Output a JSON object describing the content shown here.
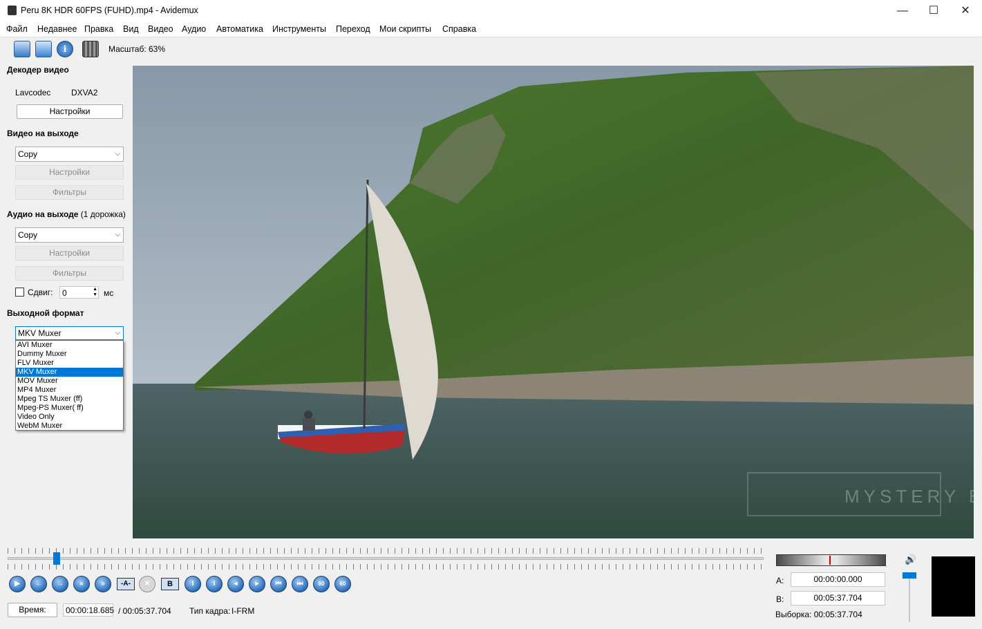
{
  "window": {
    "title": "Peru 8K HDR 60FPS (FUHD).mp4 - Avidemux",
    "minimize": "—",
    "maximize": "☐",
    "close": "✕"
  },
  "menu": [
    "Файл",
    "Недавнее",
    "Правка",
    "Вид",
    "Видео",
    "Аудио",
    "Автоматика",
    "Инструменты",
    "Переход",
    "Мои скрипты",
    "Справка"
  ],
  "toolbar": {
    "zoom": "Масштаб: 63%"
  },
  "decoder": {
    "title": "Декодер видео",
    "codec": "Lavcodec",
    "hw": "DXVA2",
    "settings": "Настройки"
  },
  "video_out": {
    "title": "Видео на выходе",
    "codec": "Copy",
    "settings": "Настройки",
    "filters": "Фильтры"
  },
  "audio_out": {
    "title": "Аудио на выходе",
    "tracks": "(1 дорожка)",
    "codec": "Copy",
    "settings": "Настройки",
    "filters": "Фильтры",
    "shift_label": "Сдвиг:",
    "shift_value": "0",
    "shift_unit": "мс"
  },
  "output_format": {
    "title": "Выходной формат",
    "selected": "MKV Muxer",
    "options": [
      "AVI Muxer",
      "Dummy Muxer",
      "FLV Muxer",
      "MKV Muxer",
      "MOV Muxer",
      "MP4 Muxer",
      "Mpeg TS Muxer (ff)",
      "Mpeg-PS Muxer( ff)",
      "Video Only",
      "WebM Muxer"
    ]
  },
  "video": {
    "watermark": "MYSTERY BOX"
  },
  "timeline": {
    "position_fraction": 0.065
  },
  "controls": {
    "a_label": "-A-",
    "b_label": "B",
    "sixty": "60"
  },
  "status": {
    "time_button": "Время:",
    "current": "00:00:18.685",
    "total": "/ 00:05:37.704",
    "frame_type_label": "Тип кадра:",
    "frame_type": "I-FRM"
  },
  "selection": {
    "a_label": "A:",
    "a_value": "00:00:00.000",
    "b_label": "B:",
    "b_value": "00:05:37.704",
    "selection_text": "Выборка: 00:05:37.704"
  },
  "volume": {
    "level_fraction": 0.95
  }
}
